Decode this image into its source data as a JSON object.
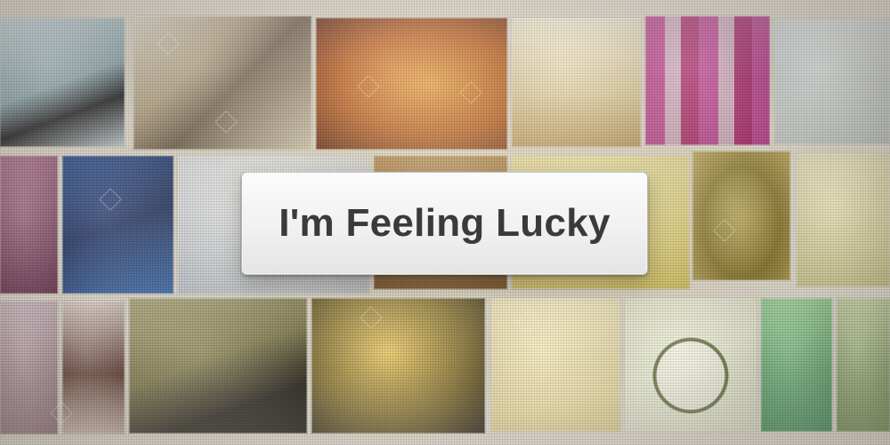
{
  "button": {
    "label": "I'm Feeling Lucky"
  },
  "colors": {
    "button_text": "#3a3a3a",
    "button_bg_top": "#fbfbfb",
    "button_bg_bottom": "#e4e4e4"
  },
  "background": {
    "description_icons": [
      "photo-thumbnail-grid"
    ]
  }
}
